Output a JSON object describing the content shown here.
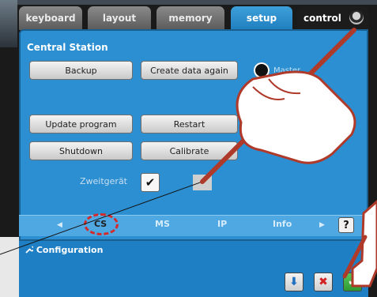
{
  "tabs": [
    {
      "label": "keyboard"
    },
    {
      "label": "layout"
    },
    {
      "label": "memory"
    },
    {
      "label": "setup"
    },
    {
      "label": "control"
    }
  ],
  "section_title": "Central Station",
  "buttons": {
    "backup": "Backup",
    "create_data_again": "Create data again",
    "update_program": "Update program",
    "restart": "Restart",
    "shutdown": "Shutdown",
    "calibrate": "Calibrate"
  },
  "radio_label": "Master",
  "zweitgeraet": {
    "label": "Zweitgerät",
    "checked": true,
    "check_glyph": "✔"
  },
  "nav": {
    "prev_glyph": "◀",
    "next_glyph": "▶",
    "items": [
      "CS",
      "MS",
      "IP",
      "Info"
    ],
    "help": "?"
  },
  "config": {
    "title": "Configuration",
    "icon": "wrench-icon"
  },
  "actions": {
    "down": "⬇",
    "cancel": "✖",
    "confirm": "✔"
  },
  "colors": {
    "panel": "#2b8fd2",
    "active_tab": "#2f95d6",
    "highlight_ring": "#d42a2a",
    "hand_arrow": "#c0392b"
  }
}
